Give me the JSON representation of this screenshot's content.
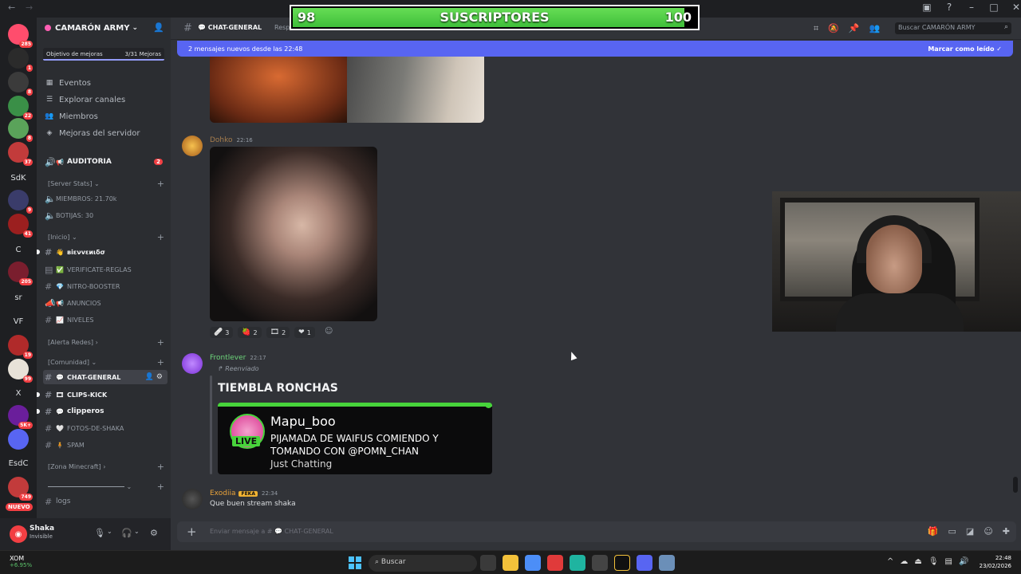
{
  "overlay": {
    "low": "98",
    "label": "SUSCRIPTORES",
    "high": "100",
    "progress_fraction": 0.97
  },
  "guild": {
    "name": "CAMARÓN ARMY",
    "boost_label": "Objetivo de mejoras",
    "boost_count": "3/31 Mejoras"
  },
  "rail": {
    "nuevo": "NUEVO",
    "servers": [
      {
        "t": "",
        "b": "285"
      },
      {
        "t": "",
        "b": "1"
      },
      {
        "t": "",
        "b": "8"
      },
      {
        "t": "",
        "b": "22"
      },
      {
        "t": "",
        "b": "8"
      },
      {
        "t": "",
        "b": "37"
      },
      {
        "t": "SdK",
        "b": ""
      },
      {
        "t": "",
        "b": "9"
      },
      {
        "t": "",
        "b": "41"
      },
      {
        "t": "C",
        "b": ""
      },
      {
        "t": "",
        "b": "205"
      },
      {
        "t": "sr",
        "b": ""
      },
      {
        "t": "VF",
        "b": ""
      },
      {
        "t": "",
        "b": "19"
      },
      {
        "t": "",
        "b": "99"
      },
      {
        "t": "X",
        "b": ""
      },
      {
        "t": "",
        "b": "5K+"
      },
      {
        "t": "",
        "b": ""
      },
      {
        "t": "EsdC",
        "b": ""
      },
      {
        "t": "",
        "b": "749"
      }
    ]
  },
  "nav": {
    "eventos": "Eventos",
    "explorar": "Explorar canales",
    "miembros": "Miembros",
    "mejoras": "Mejoras del servidor"
  },
  "channels": {
    "auditoria": "AUDITORIA",
    "auditoria_badge": "2",
    "cat_stats": "[Server Stats]",
    "stat_members": "MIEMBROS: 21.70k",
    "stat_bots": "BOTIJAS: 30",
    "cat_inicio": "[Inicio]",
    "bienvenido": "віενvεиιδσ",
    "verificate": "VERIFICATE-REGLAS",
    "nitro": "NITRO-BOOSTER",
    "anuncios": "ANUNCIOS",
    "niveles": "NIVELES",
    "cat_alerta": "[Alerta Redes]",
    "cat_comunidad": "[Comunidad]",
    "chat": "CHAT-GENERAL",
    "clips": "CLIPS-KICK",
    "clipperos": "clipperos",
    "fotos": "FOTOS-DE-SHAKA",
    "spam": "SPAM",
    "cat_mine": "[Zona Minecraft]",
    "logs": "logs"
  },
  "user": {
    "name": "Shaka",
    "status": "Invisible"
  },
  "header": {
    "channel": "CHAT-GENERAL",
    "resp": "Respo",
    "search_placeholder": "Buscar CAMARÓN ARMY"
  },
  "newbar": {
    "text": "2 mensajes nuevos desde las 22:48",
    "mark": "Marcar como leído"
  },
  "messages": {
    "m1_user": "Dohko",
    "m1_time": "22:16",
    "reactions": [
      {
        "e": "🩹",
        "n": "3"
      },
      {
        "e": "🍓",
        "n": "2"
      },
      {
        "e": "🎞",
        "n": "2"
      },
      {
        "e": "❤",
        "n": "1"
      }
    ],
    "m2_user": "Frontlever",
    "m2_time": "22:17",
    "forwarded": "Reenviado",
    "fwd_title": "TIEMBLA RONCHAS",
    "card_name": "Mapu_boo",
    "card_live": "LIVE",
    "card_title": "PIJAMADA DE WAIFUS COMIENDO Y TOMANDO CON @POMN_CHAN",
    "card_game": "Just Chatting",
    "m3_user": "Exodiia",
    "m3_tag": "FEKA",
    "m3_time": "22:34",
    "m3_text": "Que buen stream shaka"
  },
  "composer": {
    "placeholder": "Enviar mensaje a #",
    "channel": "CHAT-GENERAL"
  },
  "taskbar": {
    "stock": "XOM",
    "stock_change": "+6.95%",
    "search": "Buscar",
    "time": "22:48",
    "date": "23/02/2026"
  },
  "colors": {
    "accent": "#5865f2",
    "live_green": "#47d43b",
    "badge_red": "#f23f43"
  }
}
